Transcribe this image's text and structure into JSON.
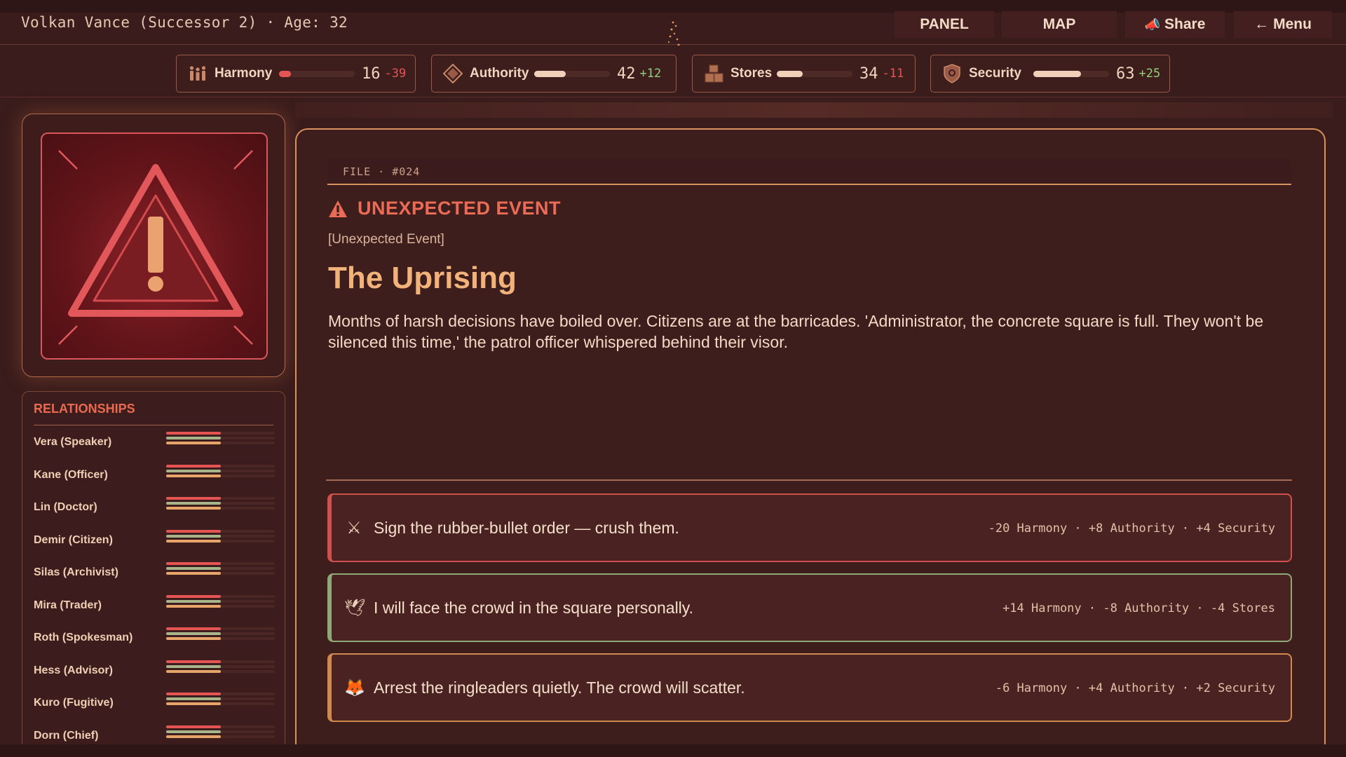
{
  "header": {
    "character": "Volkan Vance (Successor 2) · Age: 32",
    "nav": [
      {
        "label": "PANEL",
        "icon": ""
      },
      {
        "label": "MAP",
        "icon": ""
      },
      {
        "label": "Share",
        "icon": "📣"
      },
      {
        "label": "Menu",
        "icon": "←"
      }
    ]
  },
  "stats": [
    {
      "name": "Harmony",
      "value": "16",
      "delta": "-39",
      "fraction": 0.16,
      "color": "#e45554",
      "delta_color": "#e45554",
      "icon": "people-icon"
    },
    {
      "name": "Authority",
      "value": "42",
      "delta": "+12",
      "fraction": 0.42,
      "color": "#f0d0b8",
      "delta_color": "#8fd17a",
      "icon": "diamond-icon"
    },
    {
      "name": "Stores",
      "value": "34",
      "delta": "-11",
      "fraction": 0.34,
      "color": "#f0d0b8",
      "delta_color": "#e45554",
      "icon": "crates-icon"
    },
    {
      "name": "Security",
      "value": "63",
      "delta": "+25",
      "fraction": 0.63,
      "color": "#f0d0b8",
      "delta_color": "#8fd17a",
      "icon": "shield-icon"
    }
  ],
  "relationships": {
    "title": "RELATIONSHIPS",
    "people": [
      {
        "name": "Vera (Speaker)"
      },
      {
        "name": "Kane (Officer)"
      },
      {
        "name": "Lin (Doctor)"
      },
      {
        "name": "Demir (Citizen)"
      },
      {
        "name": "Silas (Archivist)"
      },
      {
        "name": "Mira (Trader)"
      },
      {
        "name": "Roth (Spokesman)"
      },
      {
        "name": "Hess (Advisor)"
      },
      {
        "name": "Kuro (Fugitive)"
      },
      {
        "name": "Dorn (Chief)"
      }
    ]
  },
  "event": {
    "file": "FILE · #024",
    "type": "UNEXPECTED EVENT",
    "subtype": "[Unexpected Event]",
    "title": "The Uprising",
    "body": "Months of harsh decisions have boiled over. Citizens are at the barricades. 'Administrator, the concrete square is full. They won't be silenced this time,' the patrol officer whispered behind their visor."
  },
  "choices": [
    {
      "icon": "⚔",
      "icon_name": "crossed-swords-icon",
      "text": "Sign the rubber-bullet order — crush them.",
      "effects": "-20 Harmony  ·  +8 Authority  ·  +4 Security",
      "border": "#d0504e"
    },
    {
      "icon": "🕊",
      "icon_name": "dove-icon",
      "text": "I will face the crowd in the square personally.",
      "effects": "+14 Harmony  ·  -8 Authority  ·  -4 Stores",
      "border": "#8fa877"
    },
    {
      "icon": "🦊",
      "icon_name": "fox-icon",
      "text": "Arrest the ringleaders quietly. The crowd will scatter.",
      "effects": "-6 Harmony  ·  +4 Authority  ·  +2 Security",
      "border": "#d08a4e"
    }
  ]
}
